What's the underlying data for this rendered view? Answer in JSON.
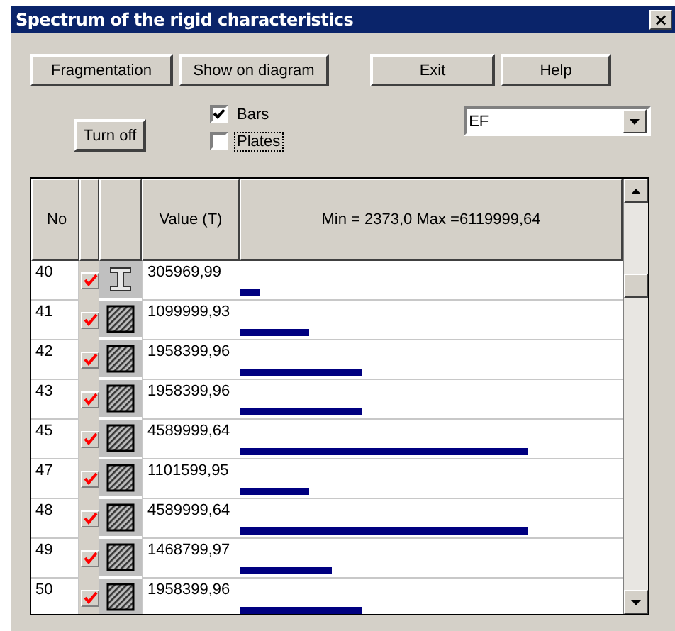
{
  "window": {
    "title": "Spectrum of the rigid characteristics",
    "close": "×"
  },
  "buttons": [
    "Fragmentation",
    "Show on diagram",
    "Exit",
    "Help"
  ],
  "turn_off": "Turn off",
  "checkboxes": [
    {
      "label": "Bars",
      "checked": true
    },
    {
      "label": "Plates",
      "checked": false
    }
  ],
  "dropdown": {
    "value": "EF"
  },
  "table": {
    "columns": [
      "No",
      "Value (T)",
      "Min = 2373,0 Max =6119999,64"
    ],
    "rows": [
      {
        "no": "40",
        "checked": true,
        "kind": "ibeam",
        "value": "305969,99",
        "level": 0.05
      },
      {
        "no": "41",
        "checked": true,
        "kind": "hatched",
        "value": "1099999,93",
        "level": 0.18
      },
      {
        "no": "42",
        "checked": true,
        "kind": "hatched",
        "value": "1958399,96",
        "level": 0.32
      },
      {
        "no": "43",
        "checked": true,
        "kind": "hatched",
        "value": "1958399,96",
        "level": 0.32
      },
      {
        "no": "45",
        "checked": true,
        "kind": "hatched",
        "value": "4589999,64",
        "level": 0.75
      },
      {
        "no": "47",
        "checked": true,
        "kind": "hatched",
        "value": "1101599,95",
        "level": 0.18
      },
      {
        "no": "48",
        "checked": true,
        "kind": "hatched",
        "value": "4589999,64",
        "level": 0.75
      },
      {
        "no": "49",
        "checked": true,
        "kind": "hatched",
        "value": "1468799,97",
        "level": 0.24
      },
      {
        "no": "50",
        "checked": true,
        "kind": "hatched",
        "value": "1958399,96",
        "level": 0.32
      }
    ]
  }
}
